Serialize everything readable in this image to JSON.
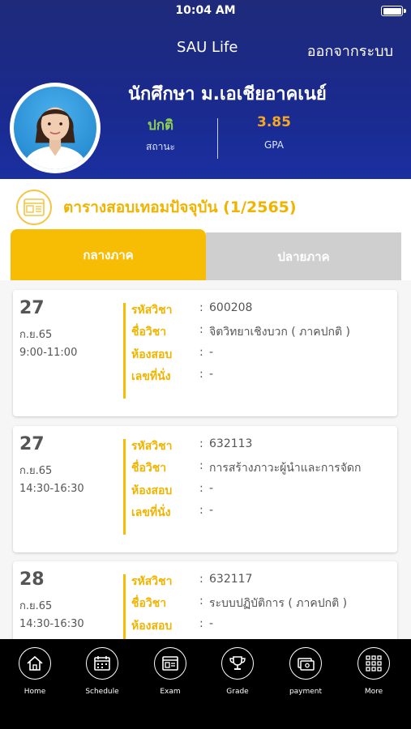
{
  "status_bar": {
    "time": "10:04 AM"
  },
  "header": {
    "app_title": "SAU Life",
    "logout_label": "ออกจากระบบ",
    "student_name": "นักศึกษา ม.เอเชียอาคเนย์",
    "status_value": "ปกติ",
    "status_label": "สถานะ",
    "gpa_value": "3.85",
    "gpa_label": "GPA"
  },
  "section": {
    "icon": "exam-schedule-icon",
    "title": "ตารางสอบเทอมปัจจุบัน (1/2565)"
  },
  "tabs": [
    {
      "label": "กลางภาค",
      "active": true
    },
    {
      "label": "ปลายภาค",
      "active": false
    }
  ],
  "field_labels": {
    "code": "รหัสวิชา",
    "name": "ชื่อวิชา",
    "room": "ห้องสอบ",
    "seat": "เลขที่นั่ง",
    "sep": ":"
  },
  "exams": [
    {
      "day": "27",
      "month": "ก.ย.65",
      "time": "9:00-11:00",
      "code": "600208",
      "name": "จิตวิทยาเชิงบวก ( ภาคปกติ )",
      "room": "-",
      "seat": "-"
    },
    {
      "day": "27",
      "month": "ก.ย.65",
      "time": "14:30-16:30",
      "code": "632113",
      "name": "การสร้างภาวะผู้นำและการจัดก",
      "room": "-",
      "seat": "-"
    },
    {
      "day": "28",
      "month": "ก.ย.65",
      "time": "14:30-16:30",
      "code": "632117",
      "name": "ระบบปฏิบัติการ ( ภาคปกติ )",
      "room": "-",
      "seat": ""
    }
  ],
  "nav": [
    {
      "label": "Home",
      "icon": "home-icon"
    },
    {
      "label": "Schedule",
      "icon": "calendar-icon"
    },
    {
      "label": "Exam",
      "icon": "exam-icon"
    },
    {
      "label": "Grade",
      "icon": "trophy-icon"
    },
    {
      "label": "payment",
      "icon": "payment-icon"
    },
    {
      "label": "More",
      "icon": "grid-icon"
    }
  ],
  "colors": {
    "header_bg": "#1a2a8e",
    "accent": "#f7bd05",
    "status_green": "#8fd14f",
    "gpa_orange": "#f5a623"
  }
}
